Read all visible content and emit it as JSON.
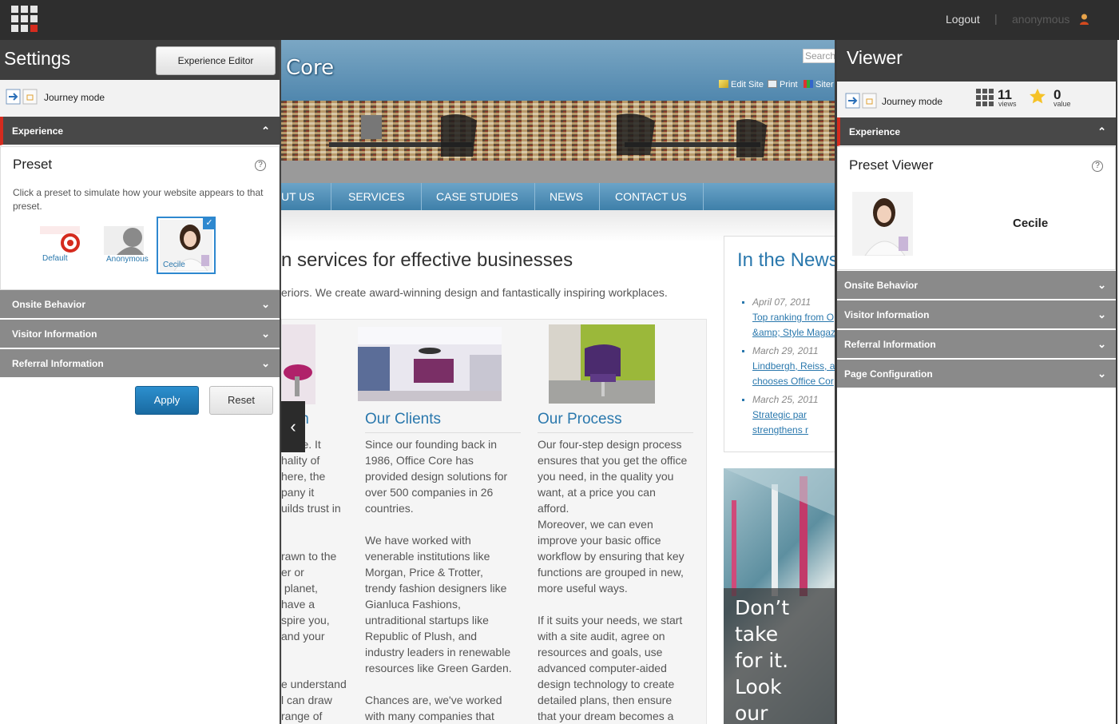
{
  "topbar": {
    "logout": "Logout",
    "separator": "|",
    "user": "anonymous"
  },
  "settings": {
    "title": "Settings",
    "experience_editor": "Experience Editor",
    "journey_mode": "Journey mode",
    "sections": {
      "experience": "Experience",
      "onsite": "Onsite Behavior",
      "visitor": "Visitor Information",
      "referral": "Referral Information"
    },
    "preset": {
      "title": "Preset",
      "help": "?",
      "description": "Click a preset to simulate how your website appears to that preset.",
      "presets": [
        {
          "label": "Default"
        },
        {
          "label": "Anonymous"
        },
        {
          "label": "Cecile",
          "selected": true
        }
      ]
    },
    "apply": "Apply",
    "reset": "Reset"
  },
  "site": {
    "logo": "Core",
    "search_placeholder": "Search",
    "toolbar": {
      "edit": "Edit Site",
      "print": "Print",
      "sitemap": "Siter"
    },
    "nav": [
      "UT US",
      "SERVICES",
      "CASE STUDIES",
      "NEWS",
      "CONTACT US"
    ],
    "headline": "n services for effective businesses",
    "subhead": "eriors. We create award-winning design and fantastically inspiring workplaces.",
    "columns": [
      {
        "title": "sign",
        "text": "nique. It\nhality of\nhere, the\npany it\nuilds trust in\n\n\nrawn to the\ner or\n planet,\nhave a\nspire you,\nand your\n\n\ne understand\nl can draw\nrange of"
      },
      {
        "title": "Our Clients",
        "text": "Since our founding back in\n1986, Office Core has\nprovided design solutions for\nover 500 companies in 26\ncountries.\n\nWe have worked with\nvenerable institutions like\nMorgan, Price & Trotter,\ntrendy fashion designers like\nGianluca Fashions,\nuntraditional startups like\nRepublic of Plush, and\nindustry leaders in renewable\nresources like Green Garden.\n\nChances are, we've worked\nwith many companies that"
      },
      {
        "title": "Our Process",
        "text": "Our four-step design process\nensures that you get the office\nyou need, in the quality you\nwant, at a price you can\nafford.\nMoreover, we can even\nimprove your basic office\nworkflow by ensuring that key\nfunctions are grouped in new,\nmore useful ways.\n\nIf it suits your needs, we start\nwith a site audit, agree on\nresources and goals, use\nadvanced computer-aided\ndesign technology to create\ndetailed plans, then ensure\nthat your dream becomes a"
      }
    ],
    "news": {
      "title": "In the News",
      "items": [
        {
          "date": "April 07, 2011",
          "line1": "Top ranking from O",
          "line2": "&amp; Style Magaz"
        },
        {
          "date": "March 29, 2011",
          "line1": "Lindbergh, Reiss, a",
          "line2": "chooses Office Cor"
        },
        {
          "date": "March 25, 2011",
          "line1": "Strategic par",
          "line2": "strengthens r"
        }
      ]
    },
    "promo": "Don’t take\nfor it. Look\nour clients\nOffice Core"
  },
  "viewer": {
    "title": "Viewer",
    "journey_mode": "Journey mode",
    "views_value": "11",
    "views_label": "views",
    "value_value": "0",
    "value_label": "value",
    "sections": {
      "experience": "Experience",
      "onsite": "Onsite Behavior",
      "visitor": "Visitor Information",
      "referral": "Referral Information",
      "page": "Page Configuration"
    },
    "preset_viewer": {
      "title": "Preset Viewer",
      "help": "?",
      "name": "Cecile"
    }
  },
  "colors": {
    "accent": "#d52b1e",
    "link": "#2a78ad",
    "apply": "#1f7dbb",
    "section_gray": "#8a8a8a",
    "section_dark": "#484848"
  }
}
